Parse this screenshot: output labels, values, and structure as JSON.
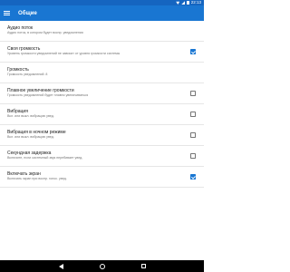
{
  "status": {
    "time": "22:13"
  },
  "appbar": {
    "title": "Общие"
  },
  "settings": [
    {
      "title": "Аудио поток",
      "subtitle": "Аудио поток, в котором будет воспр. уведомления",
      "checkbox": null
    },
    {
      "title": "Своя громкость",
      "subtitle": "Уровень громкости уведомлений не зависит от уровня громкости системы",
      "checkbox": true
    },
    {
      "title": "Громкость",
      "subtitle": "Громкость уведомлений: 8",
      "checkbox": null
    },
    {
      "title": "Плавное увеличение громкости",
      "subtitle": "Громкость уведомлений будет плавно увеличиваться",
      "checkbox": false
    },
    {
      "title": "Вибрация",
      "subtitle": "Вкл. или выкл. вибрацию увед.",
      "checkbox": false
    },
    {
      "title": "Вибрация в ночном режиме",
      "subtitle": "Вкл. или выкл. вибрацию увед.",
      "checkbox": false
    },
    {
      "title": "Секундная задержка",
      "subtitle": "Включите, если системный звук перебивает увед.",
      "checkbox": false
    },
    {
      "title": "Включать экран",
      "subtitle": "Включать экран при воспр. голос. увед.",
      "checkbox": true
    }
  ],
  "colors": {
    "accent": "#1976d2",
    "statusbar": "#1565c0"
  }
}
